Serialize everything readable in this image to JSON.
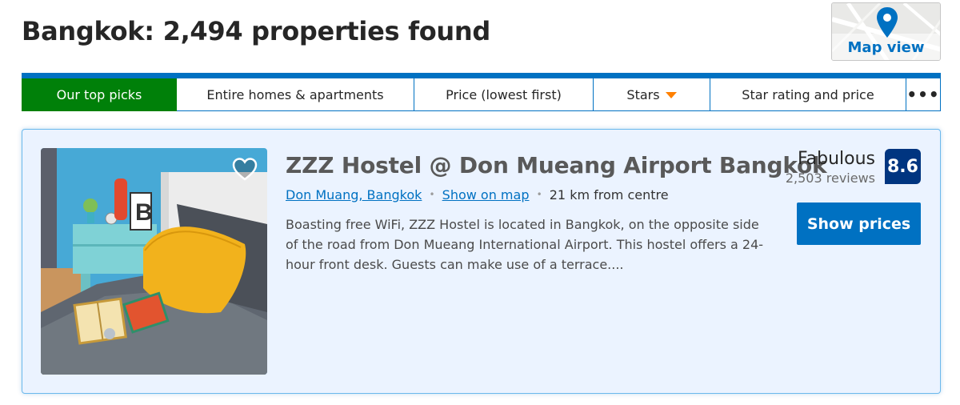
{
  "header": {
    "title": "Bangkok: 2,494 properties found",
    "map_view_label": "Map view"
  },
  "sort_bar": {
    "tabs": [
      {
        "label": "Our top picks",
        "active": true
      },
      {
        "label": "Entire homes & apartments",
        "active": false
      },
      {
        "label": "Price (lowest first)",
        "active": false
      },
      {
        "label": "Stars",
        "active": false
      },
      {
        "label": "Star rating and price",
        "active": false
      }
    ],
    "more_label": "•••"
  },
  "property": {
    "name": "ZZZ Hostel @ Don Mueang Airport Bangkok",
    "location_link": "Don Muang, Bangkok",
    "show_on_map": "Show on map",
    "distance": "21 km from centre",
    "description": "Boasting free WiFi, ZZZ Hostel is located in Bangkok, on the opposite side of the road from Don Mueang International Airport. This hostel offers a 24-hour front desk. Guests can make use of a terrace....",
    "review_word": "Fabulous",
    "review_count": "2,503 reviews",
    "score": "8.6",
    "cta_label": "Show prices"
  },
  "colors": {
    "brand_blue": "#0071c2",
    "active_green": "#008009",
    "score_navy": "#003580",
    "card_bg": "#ebf3ff"
  },
  "icons": {
    "map_pin": "map-pin-icon",
    "heart": "heart-icon",
    "caret": "caret-down-icon",
    "more": "more-icon"
  }
}
